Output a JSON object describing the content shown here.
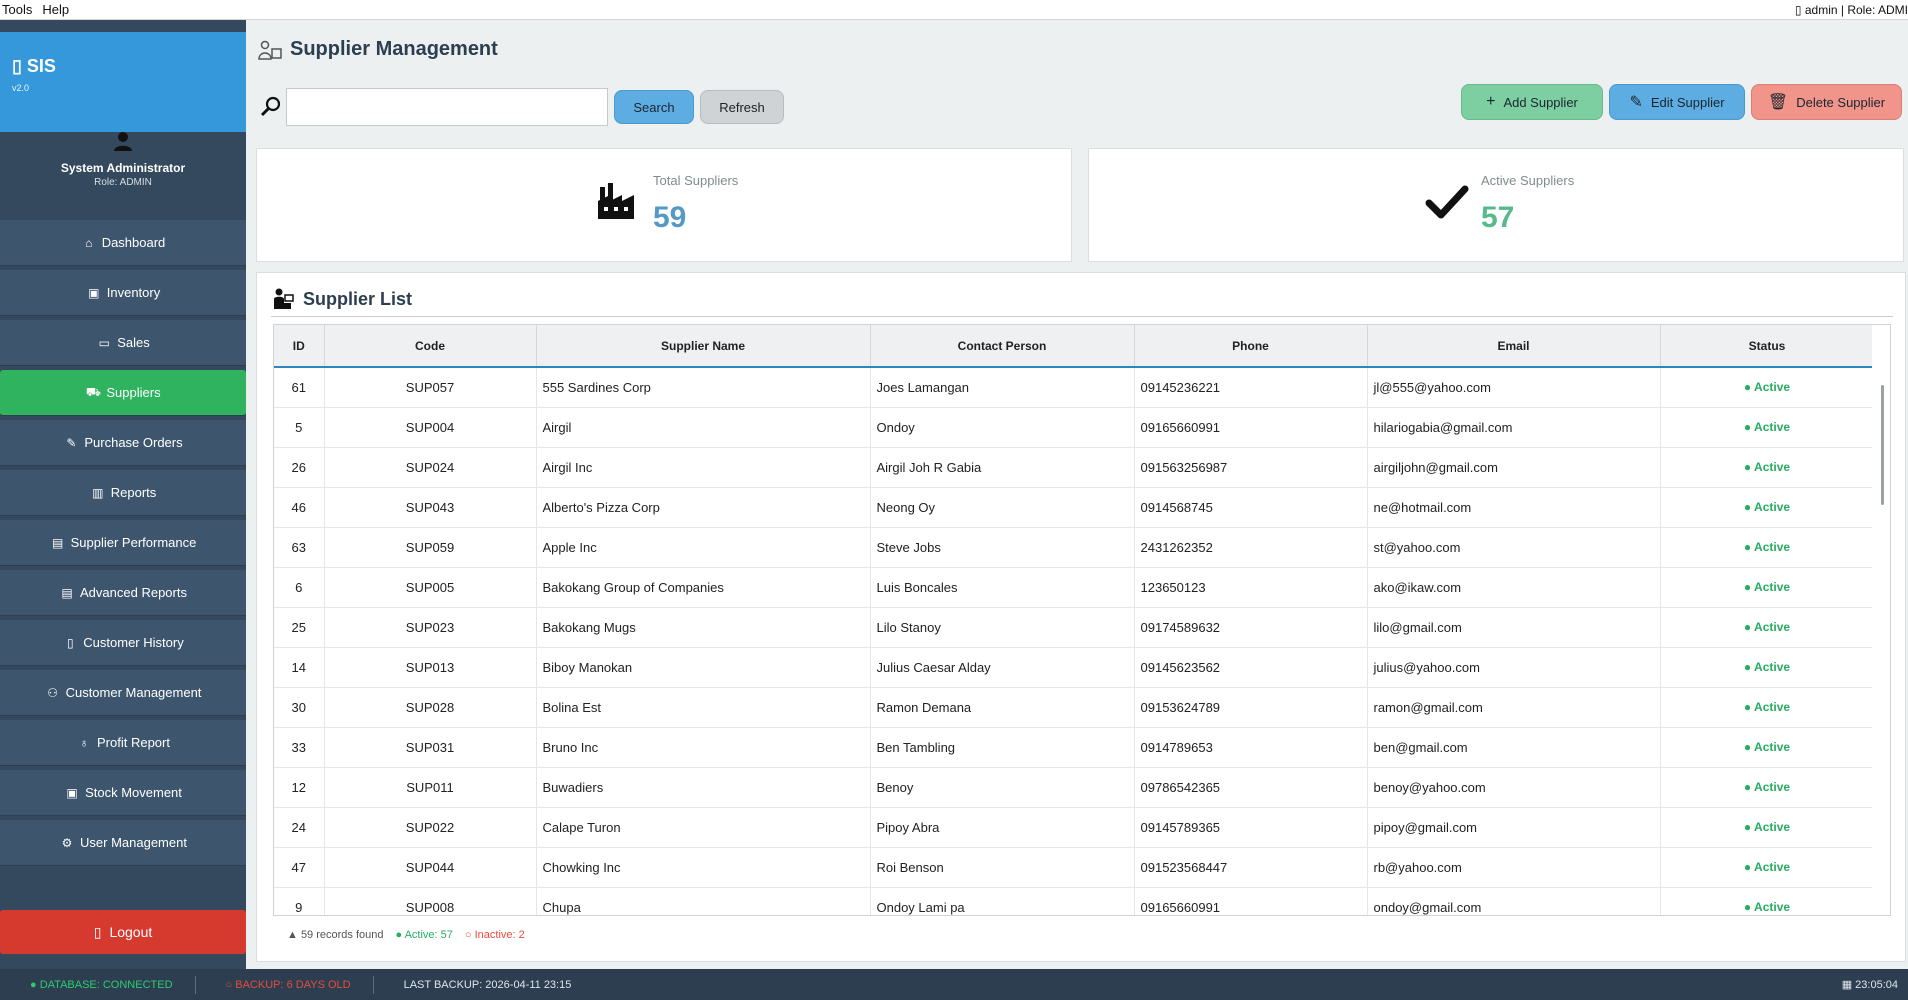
{
  "menubar": {
    "items": [
      "Tools",
      "Help"
    ],
    "user_info": "▯ admin | Role: ADMI"
  },
  "sidebar": {
    "app_name": "▯ SIS",
    "version": "v2.0",
    "user_name": "System Administrator",
    "user_role": "Role: ADMIN",
    "nav": [
      {
        "label": "Dashboard",
        "icon": "home-icon"
      },
      {
        "label": "Inventory",
        "icon": "box-icon"
      },
      {
        "label": "Sales",
        "icon": "cash-register-icon"
      },
      {
        "label": "Suppliers",
        "icon": "truck-icon",
        "active": true
      },
      {
        "label": "Purchase Orders",
        "icon": "document-edit-icon"
      },
      {
        "label": "Reports",
        "icon": "bar-chart-icon"
      },
      {
        "label": "Supplier Performance",
        "icon": "chart-icon"
      },
      {
        "label": "Advanced Reports",
        "icon": "document-icon"
      },
      {
        "label": "Customer History",
        "icon": "book-icon"
      },
      {
        "label": "Customer Management",
        "icon": "users-icon"
      },
      {
        "label": "Profit Report",
        "icon": "money-bag-icon"
      },
      {
        "label": "Stock Movement",
        "icon": "box-icon"
      },
      {
        "label": "User Management",
        "icon": "gear-icon"
      }
    ],
    "logout_label": "Logout"
  },
  "header": {
    "title": "Supplier Management"
  },
  "search": {
    "value": "",
    "button_label": "Search",
    "refresh_label": "Refresh"
  },
  "actions": {
    "add_label": "Add Supplier",
    "edit_label": "Edit Supplier",
    "delete_label": "Delete Supplier"
  },
  "stats": {
    "total_label": "Total Suppliers",
    "total_value": "59",
    "active_label": "Active Suppliers",
    "active_value": "57"
  },
  "list": {
    "title": "Supplier List",
    "columns": [
      "ID",
      "Code",
      "Supplier Name",
      "Contact Person",
      "Phone",
      "Email",
      "Status"
    ],
    "rows": [
      [
        "61",
        "SUP057",
        "555 Sardines Corp",
        "Joes Lamangan",
        "09145236221",
        "jl@555@yahoo.com",
        "● Active"
      ],
      [
        "5",
        "SUP004",
        "Airgil",
        "Ondoy",
        "09165660991",
        "hilariogabia@gmail.com",
        "● Active"
      ],
      [
        "26",
        "SUP024",
        "Airgil Inc",
        "Airgil Joh R Gabia",
        "091563256987",
        "airgiljohn@gmail.com",
        "● Active"
      ],
      [
        "46",
        "SUP043",
        "Alberto's Pizza Corp",
        "Neong Oy",
        "0914568745",
        "ne@hotmail.com",
        "● Active"
      ],
      [
        "63",
        "SUP059",
        "Apple Inc",
        "Steve Jobs",
        "2431262352",
        "st@yahoo.com",
        "● Active"
      ],
      [
        "6",
        "SUP005",
        "Bakokang Group of Companies",
        "Luis Boncales",
        "123650123",
        "ako@ikaw.com",
        "● Active"
      ],
      [
        "25",
        "SUP023",
        "Bakokang Mugs",
        "Lilo Stanoy",
        "09174589632",
        "lilo@gmail.com",
        "● Active"
      ],
      [
        "14",
        "SUP013",
        "Biboy Manokan",
        "Julius Caesar Alday",
        "09145623562",
        "julius@yahoo.com",
        "● Active"
      ],
      [
        "30",
        "SUP028",
        "Bolina Est",
        "Ramon Demana",
        "09153624789",
        "ramon@gmail.com",
        "● Active"
      ],
      [
        "33",
        "SUP031",
        "Bruno Inc",
        "Ben Tambling",
        "0914789653",
        "ben@gmail.com",
        "● Active"
      ],
      [
        "12",
        "SUP011",
        "Buwadiers",
        "Benoy",
        "09786542365",
        "benoy@yahoo.com",
        "● Active"
      ],
      [
        "24",
        "SUP022",
        "Calape Turon",
        "Pipoy Abra",
        "09145789365",
        "pipoy@gmail.com",
        "● Active"
      ],
      [
        "47",
        "SUP044",
        "Chowking Inc",
        "Roi Benson",
        "091523568447",
        "rb@yahoo.com",
        "● Active"
      ],
      [
        "9",
        "SUP008",
        "Chupa",
        "Ondoy Lami pa",
        "09165660991",
        "ondoy@gmail.com",
        "● Active"
      ]
    ],
    "footer": {
      "count": "▲ 59 records found",
      "active": "● Active: 57",
      "inactive": "○ Inactive: 2"
    }
  },
  "statusbar": {
    "db": "● DATABASE: CONNECTED",
    "backup": "○ BACKUP: 6 DAYS OLD",
    "last_backup": "LAST BACKUP: 2026-04-11 23:15",
    "clock": "▦ 23:05:04"
  },
  "colors": {
    "accent": "#3498db",
    "sidebar": "#34495e",
    "active_nav": "#2fb35f",
    "logout": "#d63a2f",
    "active_status": "#27ae60",
    "danger": "#e74c3c"
  }
}
